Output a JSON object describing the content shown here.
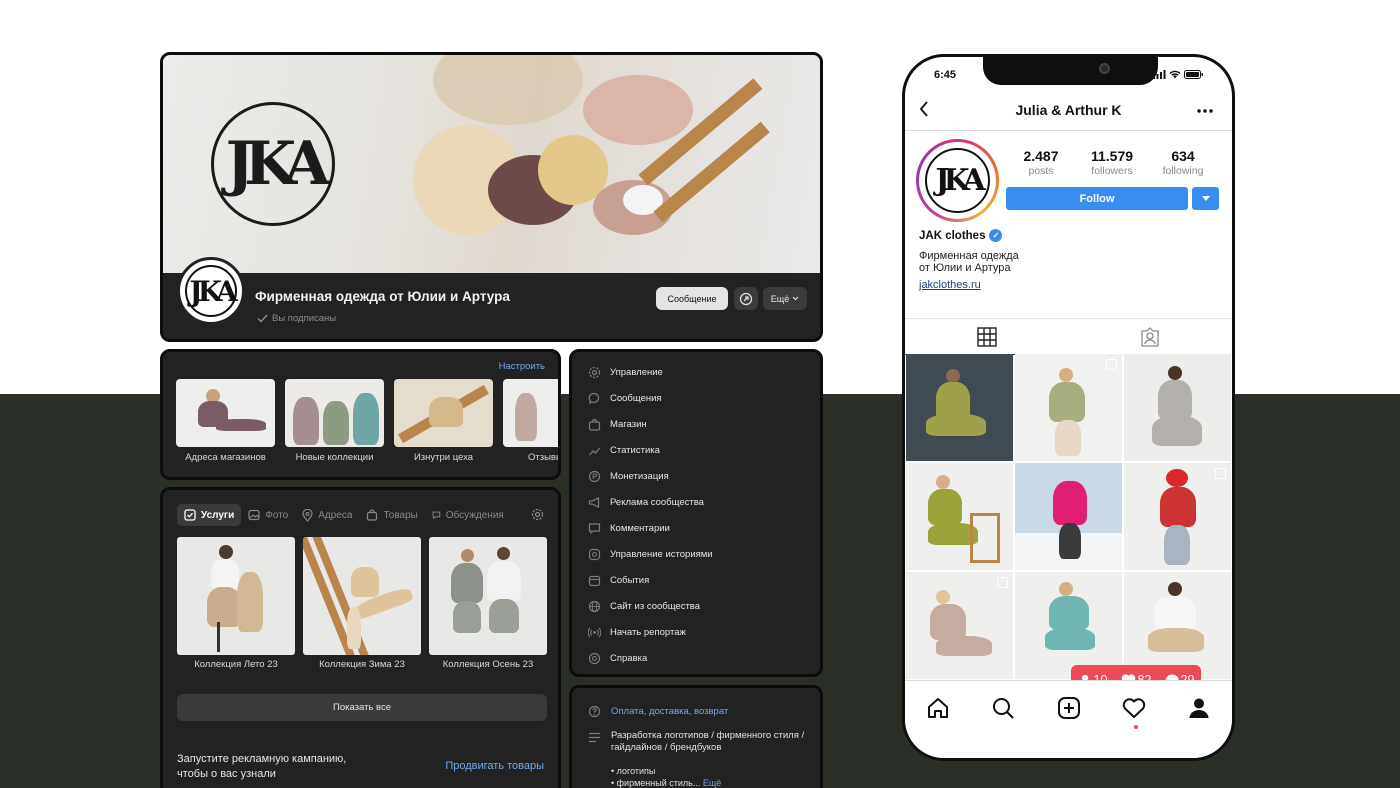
{
  "colors": {
    "accent_blue": "#71aaeb",
    "ig_blue": "#3a8df0",
    "ig_red": "#ed4956",
    "card_bg": "#222222",
    "bottom_bg": "#2a2f27"
  },
  "cover": {
    "logo_text": "JKA",
    "title": "Фирменная одежда от Юлии и Артура",
    "subscribed": "Вы подписаны",
    "message_button": "Сообщение",
    "more_button": "Ещё"
  },
  "albums": {
    "setup_link": "Настроить",
    "items": [
      {
        "label": "Адреса магазинов"
      },
      {
        "label": "Новые коллекции"
      },
      {
        "label": "Изнутри цеха"
      },
      {
        "label": "Отзывы"
      }
    ]
  },
  "services": {
    "tabs": [
      "Услуги",
      "Фото",
      "Адреса",
      "Товары",
      "Обсуждения"
    ],
    "items": [
      {
        "label": "Коллекция Лето 23"
      },
      {
        "label": "Коллекция Зима 23"
      },
      {
        "label": "Коллекция Осень 23"
      }
    ],
    "show_all": "Показать все",
    "promo_text": "Запустите рекламную кампанию, чтобы о вас узнали",
    "promo_link": "Продвигать товары"
  },
  "manage_menu": [
    {
      "label": "Управление",
      "icon": "gear-icon"
    },
    {
      "label": "Сообщения",
      "icon": "chat-icon"
    },
    {
      "label": "Магазин",
      "icon": "shop-bag-icon"
    },
    {
      "label": "Статистика",
      "icon": "chart-icon"
    },
    {
      "label": "Монетизация",
      "icon": "coin-icon"
    },
    {
      "label": "Реклама сообщества",
      "icon": "megaphone-icon"
    },
    {
      "label": "Комментарии",
      "icon": "comment-icon"
    },
    {
      "label": "Управление историями",
      "icon": "stories-icon"
    },
    {
      "label": "События",
      "icon": "calendar-icon"
    },
    {
      "label": "Сайт из сообщества",
      "icon": "globe-icon"
    },
    {
      "label": "Начать репортаж",
      "icon": "broadcast-icon"
    },
    {
      "label": "Справка",
      "icon": "help-icon"
    }
  ],
  "info": {
    "link": "Оплата, доставка, возврат",
    "description": "Разработка логотипов / фирменного стиля / гайдлайнов / брендбуков",
    "bullet1": "• логотипы",
    "bullet2": "• фирменный стиль...",
    "more": "Ещё"
  },
  "phone": {
    "time": "6:45",
    "header_title": "Julia & Arthur K",
    "stats": [
      {
        "value": "2.487",
        "label": "posts"
      },
      {
        "value": "11.579",
        "label": "followers"
      },
      {
        "value": "634",
        "label": "following"
      }
    ],
    "follow_button": "Follow",
    "name": "JAK clothes",
    "bio_line1": "Фирменная одежда",
    "bio_line2": "от Юлии и Артура",
    "link": "jakclothes.ru",
    "notifications": {
      "followers": "10",
      "likes": "82",
      "comments": "29"
    }
  }
}
